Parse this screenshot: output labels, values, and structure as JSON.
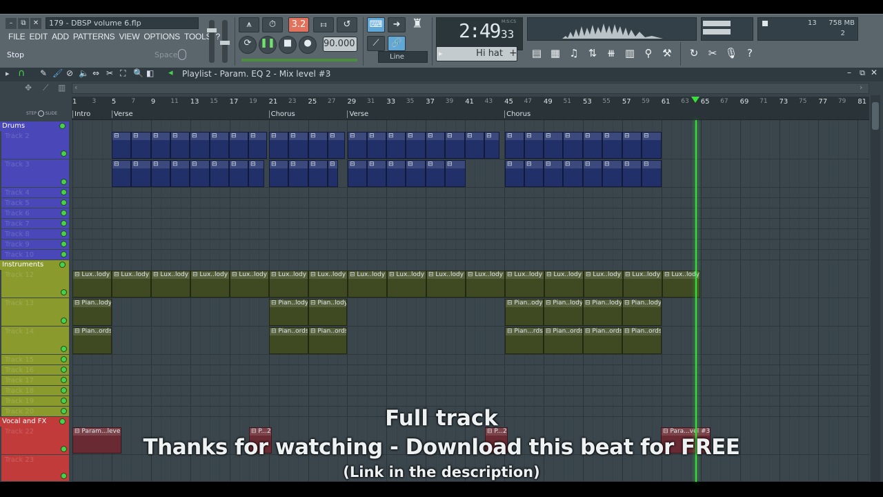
{
  "window": {
    "title": "179 - DBSP volume 6.flp",
    "buttons": [
      "–",
      "⧉",
      "✕"
    ]
  },
  "menu": [
    "FILE",
    "EDIT",
    "ADD",
    "PATTERNS",
    "VIEW",
    "OPTIONS",
    "TOOLS",
    "?"
  ],
  "hint": {
    "text": "Stop",
    "shortcut": "Space"
  },
  "transport": {
    "tempo": "90.000",
    "time": "2:49",
    "time_sub": "33",
    "time_unit": "M:S:CS",
    "pattern_mode": "3.2",
    "snap": "Line",
    "channel": "Hi hat",
    "cpu_label": "13",
    "memory": "758 MB",
    "polyphony": "2"
  },
  "playlist": {
    "title": "Playlist - Param. EQ 2 - Mix level #3",
    "arrow": "›",
    "step_label": "STEP",
    "slide_label": "SLIDE"
  },
  "ruler": {
    "bars": [
      "1",
      "3",
      "5",
      "7",
      "9",
      "11",
      "13",
      "15",
      "17",
      "19",
      "21",
      "23",
      "25",
      "27",
      "29",
      "31",
      "33",
      "35",
      "37",
      "39",
      "41",
      "43",
      "45",
      "47",
      "49",
      "51",
      "53",
      "55",
      "57",
      "59",
      "61",
      "63",
      "65",
      "67",
      "69",
      "71",
      "73",
      "75",
      "77",
      "79",
      "81"
    ],
    "markers": [
      "Intro",
      "Verse",
      "Chorus",
      "Verse",
      "Chorus"
    ]
  },
  "groups": [
    {
      "name": "Drums",
      "color": "#4a48b8"
    },
    {
      "name": "Instruments",
      "color": "#8a9a2c"
    },
    {
      "name": "Vocal and FX",
      "color": "#c23b3b"
    }
  ],
  "tracks": [
    "Track 2",
    "Track 3",
    "Track 4",
    "Track 5",
    "Track 6",
    "Track 7",
    "Track 8",
    "Track 9",
    "Track 10",
    "Track 12",
    "Track 13",
    "Track 14",
    "Track 15",
    "Track 16",
    "Track 17",
    "Track 18",
    "Track 19",
    "Track 20",
    "Track 22",
    "Track 23"
  ],
  "clips": {
    "lux": "Lux..lody",
    "pian_lody": "Pian..lody",
    "pian_ody": "Pian..ody",
    "pian_ords": "Pian..ords",
    "pian_rds": "Pian...rds",
    "param_level": "Param...level",
    "p2": "P...2",
    "para_vel3": "Para...vel #3"
  },
  "overlay": {
    "line1": "Full track",
    "line2": "Thanks for watching - Download this beat for FREE",
    "line3": "(Link in the description)"
  },
  "colors": {
    "drums_clip": "#22306a",
    "inst_clip": "#3f4a22",
    "fx_clip": "#6a2a33",
    "playhead": "#39e03c"
  }
}
